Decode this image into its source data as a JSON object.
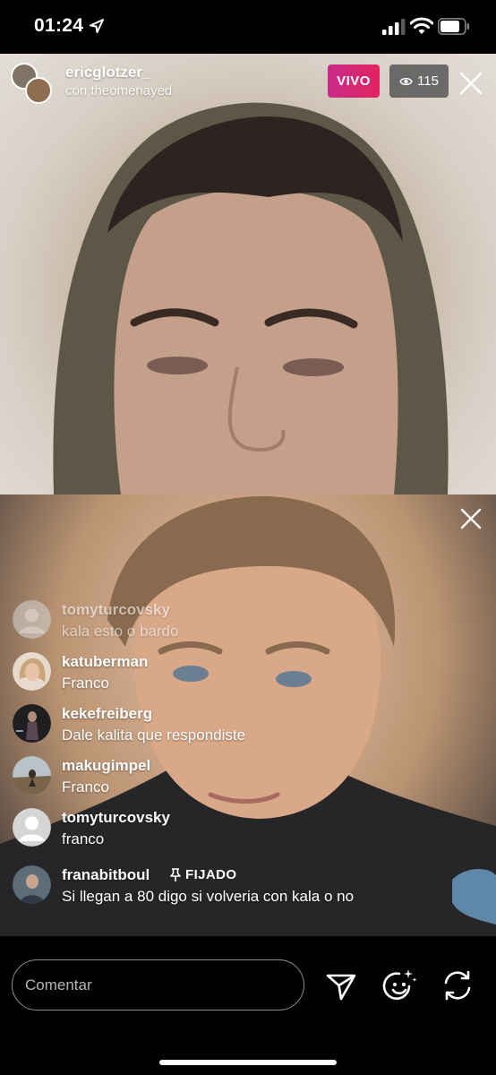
{
  "status_bar": {
    "time": "01:24"
  },
  "host": {
    "username": "ericglotzer_",
    "subtitle": "con theomenayed",
    "live_label": "VIVO",
    "viewer_count": "115"
  },
  "comments": [
    {
      "user": "tomyturcovsky",
      "text": "kala esto o bardo",
      "avatar_color": "#cfcfcf",
      "default_avatar": true,
      "faded": true
    },
    {
      "user": "katuberman",
      "text": "Franco",
      "avatar_color": "#d9c2b0",
      "default_avatar": false
    },
    {
      "user": "kekefreiberg",
      "text": "Dale kalita que respondiste",
      "avatar_color": "#2b2b2b",
      "default_avatar": false
    },
    {
      "user": "makugimpel",
      "text": "Franco",
      "avatar_color": "#7b6a55",
      "default_avatar": false
    },
    {
      "user": "tomyturcovsky",
      "text": "franco",
      "avatar_color": "#cfcfcf",
      "default_avatar": true
    },
    {
      "user": "franabitboul",
      "text": "Si llegan a 80 digo si volveria con kala o no",
      "avatar_color": "#6f7c86",
      "default_avatar": false,
      "pinned_label": "FIJADO"
    }
  ],
  "composer": {
    "placeholder": "Comentar"
  },
  "colors": {
    "live_gradient_start": "#c92b8a",
    "live_gradient_end": "#e0245e",
    "viewer_bg": "#464646"
  },
  "icons": [
    "location-arrow-icon",
    "signal-icon",
    "wifi-icon",
    "battery-icon",
    "eye-icon",
    "close-icon",
    "pin-icon",
    "send-icon",
    "face-effects-icon",
    "switch-camera-icon"
  ]
}
